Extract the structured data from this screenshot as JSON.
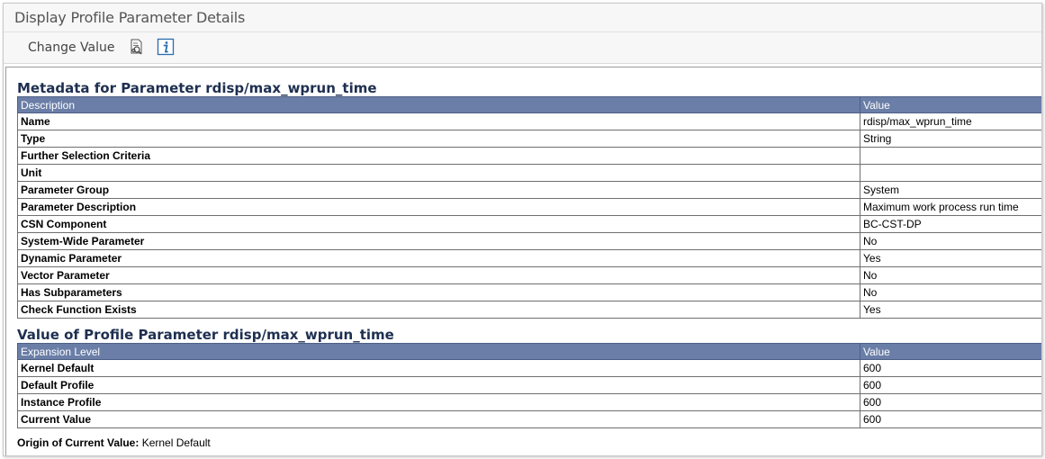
{
  "window": {
    "title": "Display Profile Parameter Details"
  },
  "toolbar": {
    "change_value_label": "Change Value",
    "icons": [
      "document-search-icon",
      "info-icon"
    ]
  },
  "metadata": {
    "title": "Metadata for Parameter rdisp/max_wprun_time",
    "columns": [
      "Description",
      "Value"
    ],
    "rows": [
      {
        "label": "Name",
        "value": "rdisp/max_wprun_time"
      },
      {
        "label": "Type",
        "value": "String"
      },
      {
        "label": "Further Selection Criteria",
        "value": ""
      },
      {
        "label": "Unit",
        "value": ""
      },
      {
        "label": "Parameter Group",
        "value": "System"
      },
      {
        "label": "Parameter Description",
        "value": "Maximum work process run time"
      },
      {
        "label": "CSN Component",
        "value": "BC-CST-DP"
      },
      {
        "label": "System-Wide Parameter",
        "value": "No"
      },
      {
        "label": "Dynamic Parameter",
        "value": "Yes"
      },
      {
        "label": "Vector Parameter",
        "value": "No"
      },
      {
        "label": "Has Subparameters",
        "value": "No"
      },
      {
        "label": "Check Function Exists",
        "value": "Yes"
      }
    ]
  },
  "value_section": {
    "title": "Value of Profile Parameter rdisp/max_wprun_time",
    "columns": [
      "Expansion Level",
      "Value"
    ],
    "rows": [
      {
        "label": "Kernel Default",
        "value": "600"
      },
      {
        "label": "Default Profile",
        "value": "600"
      },
      {
        "label": "Instance Profile",
        "value": "600"
      },
      {
        "label": "Current Value",
        "value": "600"
      }
    ]
  },
  "origin": {
    "label": "Origin of Current Value:",
    "value": "Kernel Default"
  },
  "colors": {
    "header_bg": "#6a7ea7",
    "section_title": "#1e2f50"
  }
}
